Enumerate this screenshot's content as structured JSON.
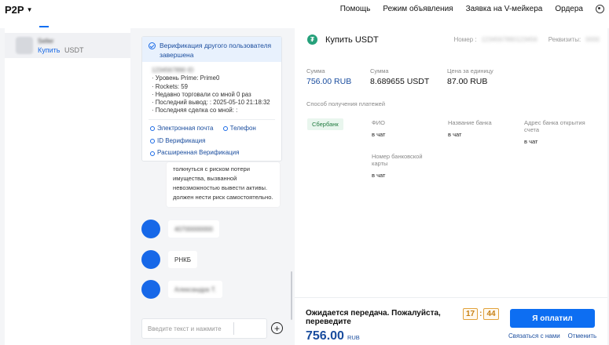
{
  "header": {
    "logo": "P2P",
    "nav": [
      "Помощь",
      "Режим объявления",
      "Заявка на V-мейкера",
      "Ордера"
    ]
  },
  "chat_list": {
    "items": [
      {
        "name": "Seller",
        "action": "Купить",
        "asset": "USDT"
      }
    ]
  },
  "verification_card": {
    "title": "Верификация другого пользователя завершена",
    "id_line": "1234567890 ID",
    "lines": [
      "· Уровень Prime: Prime0",
      "· Rockets: 59",
      "· Недавно торговали со мной 0 раз",
      "· Последний вывод: : 2025-05-10 21:18:32",
      "· Последняя сделка со мной: :"
    ],
    "links": {
      "email": "Электронная почта",
      "phone": "Телефон",
      "id_verification": "ID Верификация",
      "extended": "Расширенная Верификация"
    }
  },
  "messages": {
    "risk_text": "толкнуться с риском потери имущества, вызванной невозможностью вывести активы. должен нести риск самостоятельно.",
    "blurred_1": "40700000000",
    "bank": "РНКБ",
    "blurred_2": "Александра Т."
  },
  "input": {
    "placeholder": "Введите текст и нажмите"
  },
  "order": {
    "title": "Купить USDT",
    "number_label": "Номер :",
    "number_value": "1234567890123456",
    "requisites_label": "Реквизиты:",
    "requisites_value": "0000",
    "amount_label": "Сумма",
    "amount_value": "756.00 RUB",
    "qty_label": "Сумма",
    "qty_value": "8.689655 USDT",
    "price_label": "Цена за единицу",
    "price_value": "87.00 RUB",
    "payment_methods_label": "Способ получения платежей",
    "bank_tag": "Сбербанк",
    "fields": [
      {
        "label": "ФИО",
        "value": "в чат"
      },
      {
        "label": "Название банка",
        "value": "в чат"
      },
      {
        "label": "Адрес банка открытия счета",
        "value": "в чат"
      },
      {
        "label": "Номер банковской карты",
        "value": "в чат"
      }
    ]
  },
  "footer": {
    "message": "Ожидается передача. Пожалуйста, переведите",
    "timer_min": "17",
    "timer_sec": "44",
    "amount": "756.00",
    "currency": "RUB",
    "paid_button": "Я оплатил",
    "contact_link": "Связаться с нами",
    "cancel_link": "Отменить"
  },
  "colors": {
    "accent": "#0d6ef2",
    "link": "#1a4d9e",
    "tether": "#26a17b",
    "timer": "#c77f12"
  }
}
